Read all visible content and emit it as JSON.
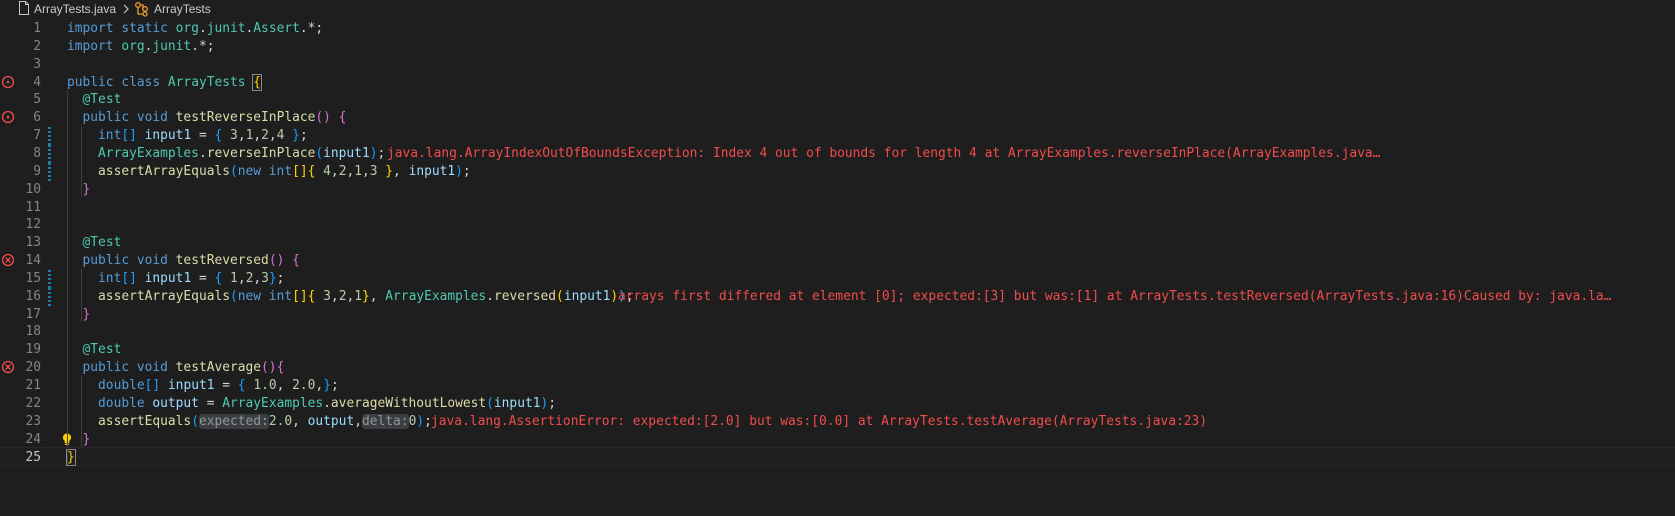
{
  "breadcrumb": {
    "file": "ArrayTests.java",
    "symbol": "ArrayTests"
  },
  "colors": {
    "background": "#1e1e1e",
    "error": "#f14c4c",
    "keyword": "#569cd6",
    "type": "#4ec9b0",
    "function": "#dcdcaa",
    "variable": "#9cdcfe",
    "number": "#b5cea8"
  },
  "editor": {
    "active_line": 25,
    "lines": [
      {
        "n": "1",
        "tokens": [
          [
            "kw",
            "import "
          ],
          [
            "kw",
            "static "
          ],
          [
            "ty",
            "org"
          ],
          [
            "pl",
            "."
          ],
          [
            "ty",
            "junit"
          ],
          [
            "pl",
            "."
          ],
          [
            "ty",
            "Assert"
          ],
          [
            "pl",
            ".*;"
          ]
        ]
      },
      {
        "n": "2",
        "tokens": [
          [
            "kw",
            "import "
          ],
          [
            "ty",
            "org"
          ],
          [
            "pl",
            "."
          ],
          [
            "ty",
            "junit"
          ],
          [
            "pl",
            ".*;"
          ]
        ]
      },
      {
        "n": "3",
        "tokens": []
      },
      {
        "n": "4",
        "glyph": "debug-hollow",
        "tokens": [
          [
            "kw",
            "public "
          ],
          [
            "kw",
            "class "
          ],
          [
            "ty",
            "ArrayTests "
          ],
          [
            "b1m",
            "{"
          ]
        ]
      },
      {
        "n": "5",
        "tokens": [
          [
            "pl",
            "  "
          ],
          [
            "ty",
            "@Test"
          ]
        ]
      },
      {
        "n": "6",
        "glyph": "debug-hollow",
        "tokens": [
          [
            "pl",
            "  "
          ],
          [
            "kw",
            "public "
          ],
          [
            "kw",
            "void "
          ],
          [
            "fn",
            "testReverseInPlace"
          ],
          [
            "b2",
            "()"
          ],
          [
            "pl",
            " "
          ],
          [
            "b2",
            "{"
          ]
        ]
      },
      {
        "n": "7",
        "mod": true,
        "tokens": [
          [
            "pl",
            "    "
          ],
          [
            "kw",
            "int"
          ],
          [
            "b3",
            "[]"
          ],
          [
            "pl",
            " "
          ],
          [
            "var",
            "input1"
          ],
          [
            "pl",
            " = "
          ],
          [
            "b3",
            "{"
          ],
          [
            "pl",
            " "
          ],
          [
            "num",
            "3"
          ],
          [
            "pl",
            ","
          ],
          [
            "num",
            "1"
          ],
          [
            "pl",
            ","
          ],
          [
            "num",
            "2"
          ],
          [
            "pl",
            ","
          ],
          [
            "num",
            "4"
          ],
          [
            "pl",
            " "
          ],
          [
            "b3",
            "}"
          ],
          [
            "pl",
            ";"
          ]
        ]
      },
      {
        "n": "8",
        "mod": true,
        "tokens": [
          [
            "pl",
            "    "
          ],
          [
            "ty",
            "ArrayExamples"
          ],
          [
            "pl",
            "."
          ],
          [
            "fn",
            "reverseInPlace"
          ],
          [
            "b3",
            "("
          ],
          [
            "var",
            "input1"
          ],
          [
            "b3",
            ")"
          ],
          [
            "pl",
            ";"
          ]
        ],
        "error": "java.lang.ArrayIndexOutOfBoundsException: Index 4 out of bounds for length 4 at ArrayExamples.reverseInPlace(ArrayExamples.java…"
      },
      {
        "n": "9",
        "mod": true,
        "tokens": [
          [
            "pl",
            "    "
          ],
          [
            "fn",
            "assertArrayEquals"
          ],
          [
            "b3",
            "("
          ],
          [
            "kw",
            "new "
          ],
          [
            "kw",
            "int"
          ],
          [
            "b1",
            "[]"
          ],
          [
            "b1",
            "{"
          ],
          [
            "pl",
            " "
          ],
          [
            "num",
            "4"
          ],
          [
            "pl",
            ","
          ],
          [
            "num",
            "2"
          ],
          [
            "pl",
            ","
          ],
          [
            "num",
            "1"
          ],
          [
            "pl",
            ","
          ],
          [
            "num",
            "3"
          ],
          [
            "pl",
            " "
          ],
          [
            "b1",
            "}"
          ],
          [
            "pl",
            ", "
          ],
          [
            "var",
            "input1"
          ],
          [
            "b3",
            ")"
          ],
          [
            "pl",
            ";"
          ]
        ]
      },
      {
        "n": "10",
        "tokens": [
          [
            "pl",
            "  "
          ],
          [
            "b2",
            "}"
          ]
        ]
      },
      {
        "n": "11",
        "tokens": []
      },
      {
        "n": "12",
        "tokens": []
      },
      {
        "n": "13",
        "tokens": [
          [
            "pl",
            "  "
          ],
          [
            "ty",
            "@Test"
          ]
        ]
      },
      {
        "n": "14",
        "glyph": "debug-fail",
        "tokens": [
          [
            "pl",
            "  "
          ],
          [
            "kw",
            "public "
          ],
          [
            "kw",
            "void "
          ],
          [
            "fn",
            "testReversed"
          ],
          [
            "b2",
            "()"
          ],
          [
            "pl",
            " "
          ],
          [
            "b2",
            "{"
          ]
        ]
      },
      {
        "n": "15",
        "mod": true,
        "tokens": [
          [
            "pl",
            "    "
          ],
          [
            "kw",
            "int"
          ],
          [
            "b3",
            "[]"
          ],
          [
            "pl",
            " "
          ],
          [
            "var",
            "input1"
          ],
          [
            "pl",
            " = "
          ],
          [
            "b3",
            "{"
          ],
          [
            "pl",
            " "
          ],
          [
            "num",
            "1"
          ],
          [
            "pl",
            ","
          ],
          [
            "num",
            "2"
          ],
          [
            "pl",
            ","
          ],
          [
            "num",
            "3"
          ],
          [
            "b3",
            "}"
          ],
          [
            "pl",
            ";"
          ]
        ]
      },
      {
        "n": "16",
        "mod": true,
        "tokens": [
          [
            "pl",
            "    "
          ],
          [
            "fn",
            "assertArrayEquals"
          ],
          [
            "b3",
            "("
          ],
          [
            "kw",
            "new "
          ],
          [
            "kw",
            "int"
          ],
          [
            "b1",
            "[]"
          ],
          [
            "b1",
            "{"
          ],
          [
            "pl",
            " "
          ],
          [
            "num",
            "3"
          ],
          [
            "pl",
            ","
          ],
          [
            "num",
            "2"
          ],
          [
            "pl",
            ","
          ],
          [
            "num",
            "1"
          ],
          [
            "b1",
            "}"
          ],
          [
            "pl",
            ", "
          ],
          [
            "ty",
            "ArrayExamples"
          ],
          [
            "pl",
            "."
          ],
          [
            "fn",
            "reversed"
          ],
          [
            "b1",
            "("
          ],
          [
            "var",
            "input1"
          ],
          [
            "b1",
            ")"
          ],
          [
            "b3",
            ")"
          ],
          [
            "pl",
            ";"
          ]
        ],
        "error": "arrays first differed at element [0]; expected:[3] but was:[1] at ArrayTests.testReversed(ArrayTests.java:16)Caused by: java.la…"
      },
      {
        "n": "17",
        "tokens": [
          [
            "pl",
            "  "
          ],
          [
            "b2",
            "}"
          ]
        ]
      },
      {
        "n": "18",
        "tokens": []
      },
      {
        "n": "19",
        "tokens": [
          [
            "pl",
            "  "
          ],
          [
            "ty",
            "@Test"
          ]
        ]
      },
      {
        "n": "20",
        "glyph": "debug-fail",
        "tokens": [
          [
            "pl",
            "  "
          ],
          [
            "kw",
            "public "
          ],
          [
            "kw",
            "void "
          ],
          [
            "fn",
            "testAverage"
          ],
          [
            "b2",
            "()"
          ],
          [
            "b2",
            "{"
          ]
        ]
      },
      {
        "n": "21",
        "tokens": [
          [
            "pl",
            "    "
          ],
          [
            "kw",
            "double"
          ],
          [
            "b3",
            "[]"
          ],
          [
            "pl",
            " "
          ],
          [
            "var",
            "input1"
          ],
          [
            "pl",
            " = "
          ],
          [
            "b3",
            "{"
          ],
          [
            "pl",
            " "
          ],
          [
            "num",
            "1.0"
          ],
          [
            "pl",
            ", "
          ],
          [
            "num",
            "2.0"
          ],
          [
            "pl",
            ","
          ],
          [
            "b3",
            "}"
          ],
          [
            "pl",
            ";"
          ]
        ]
      },
      {
        "n": "22",
        "tokens": [
          [
            "pl",
            "    "
          ],
          [
            "kw",
            "double "
          ],
          [
            "var",
            "output"
          ],
          [
            "pl",
            " = "
          ],
          [
            "ty",
            "ArrayExamples"
          ],
          [
            "pl",
            "."
          ],
          [
            "fn",
            "averageWithoutLowest"
          ],
          [
            "b3",
            "("
          ],
          [
            "var",
            "input1"
          ],
          [
            "b3",
            ")"
          ],
          [
            "pl",
            ";"
          ]
        ]
      },
      {
        "n": "23",
        "tokens": [
          [
            "pl",
            "    "
          ],
          [
            "fn",
            "assertEquals"
          ],
          [
            "b3",
            "("
          ],
          [
            "hint",
            "expected:"
          ],
          [
            "num",
            "2.0"
          ],
          [
            "pl",
            ", "
          ],
          [
            "var",
            "output"
          ],
          [
            "pl",
            ","
          ],
          [
            "hint",
            "delta:"
          ],
          [
            "num",
            "0"
          ],
          [
            "b3",
            ")"
          ],
          [
            "pl",
            ";"
          ]
        ],
        "error": "java.lang.AssertionError: expected:[2.0] but was:[0.0] at ArrayTests.testAverage(ArrayTests.java:23)"
      },
      {
        "n": "24",
        "glyph": "lightbulb",
        "tokens": [
          [
            "pl",
            "  "
          ],
          [
            "b2",
            "}"
          ]
        ]
      },
      {
        "n": "25",
        "active": true,
        "tokens": [
          [
            "b1m",
            "}"
          ]
        ]
      }
    ]
  }
}
